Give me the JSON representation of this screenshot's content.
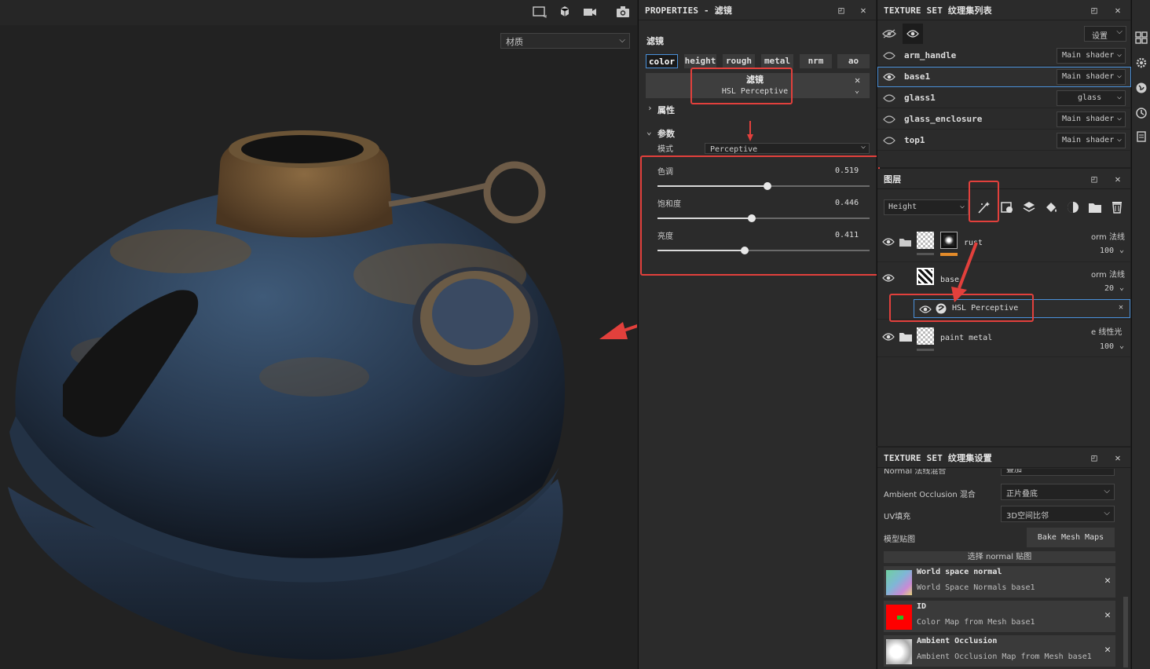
{
  "viewport": {
    "material_select": "材质"
  },
  "properties": {
    "header_title": "PROPERTIES - 滤镜",
    "section_title": "滤镜",
    "channels": [
      "color",
      "height",
      "rough",
      "metal",
      "nrm",
      "ao"
    ],
    "filter_box": {
      "title": "滤镜",
      "name": "HSL Perceptive"
    },
    "attributes_label": "属性",
    "params_label": "参数",
    "mode_label": "模式",
    "mode_value": "Perceptive",
    "sliders": [
      {
        "label": "色调",
        "value": "0.519",
        "fraction": 0.519
      },
      {
        "label": "饱和度",
        "value": "0.446",
        "fraction": 0.446
      },
      {
        "label": "亮度",
        "value": "0.411",
        "fraction": 0.411
      }
    ]
  },
  "texture_set_list": {
    "header_title": "TEXTURE SET 纹理集列表",
    "settings_label": "设置",
    "sets": [
      {
        "name": "arm_handle",
        "shader": "Main shader"
      },
      {
        "name": "base1",
        "shader": "Main shader"
      },
      {
        "name": "glass1",
        "shader": "glass"
      },
      {
        "name": "glass_enclosure",
        "shader": "Main shader"
      },
      {
        "name": "top1",
        "shader": "Main shader"
      }
    ]
  },
  "layers": {
    "header_title": "图层",
    "channel_select": "Height",
    "items": [
      {
        "name": "rust",
        "blend": "orm 法线",
        "opacity": "100"
      },
      {
        "name": "base",
        "blend": "orm 法线",
        "opacity": "20"
      },
      {
        "name": "HSL Perceptive"
      },
      {
        "name": "paint metal",
        "blend": "e 线性光",
        "opacity": "100"
      }
    ]
  },
  "texture_set_settings": {
    "header_title": "TEXTURE SET 纹理集设置",
    "cut_row_label": "Normal 法线混合",
    "cut_row_value": "叠加",
    "ao_label": "Ambient Occlusion 混合",
    "ao_value": "正片叠底",
    "uv_label": "UV填充",
    "uv_value": "3D空间比邻",
    "mesh_maps_label": "模型贴图",
    "bake_button": "Bake Mesh Maps",
    "select_normal": "选择 normal 贴图",
    "maps": [
      {
        "title": "World space normal",
        "sub": "World Space Normals base1",
        "color": "#7fb6d6"
      },
      {
        "title": "ID",
        "sub": "Color Map from Mesh base1",
        "color": "#ff0000"
      },
      {
        "title": "Ambient Occlusion",
        "sub": "Ambient Occlusion Map from Mesh base1",
        "color": "#e8e8e8"
      }
    ]
  },
  "colors": {
    "accent": "#4a90d9",
    "annotation": "#e2403c"
  }
}
